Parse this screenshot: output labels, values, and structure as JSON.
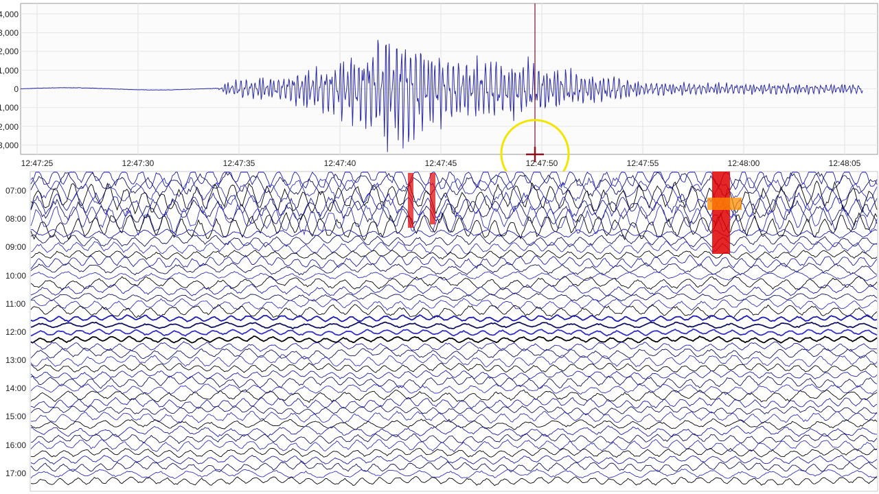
{
  "chart_data": [
    {
      "type": "line",
      "title": "",
      "xlabel": "",
      "ylabel": "",
      "x_ticks": [
        "12:47:25",
        "12:47:30",
        "12:47:35",
        "12:47:40",
        "12:47:45",
        "12:47:50",
        "12:47:55",
        "12:48:00",
        "12:48:05"
      ],
      "y_ticks": [
        {
          "value": 4000,
          "label": "4,000"
        },
        {
          "value": 3000,
          "label": "3,000"
        },
        {
          "value": 2000,
          "label": "2,000"
        },
        {
          "value": 1000,
          "label": "1,000"
        },
        {
          "value": 0,
          "label": "0"
        },
        {
          "value": -1000,
          "label": "-1,000"
        },
        {
          "value": -2000,
          "label": "-2,000"
        },
        {
          "value": -3000,
          "label": "-3,000"
        }
      ],
      "ylim": [
        -3200,
        4500
      ],
      "xlim_seconds": [
        0,
        41.7
      ],
      "grid": true,
      "series_color": "#2a2aa8",
      "envelope": [
        {
          "t": 0,
          "amp": 60
        },
        {
          "t": 9.8,
          "amp": 60
        },
        {
          "t": 10.3,
          "amp": 500
        },
        {
          "t": 13,
          "amp": 900
        },
        {
          "t": 15,
          "amp": 1600
        },
        {
          "t": 17,
          "amp": 2600
        },
        {
          "t": 18.2,
          "amp": 3800
        },
        {
          "t": 19,
          "amp": 3900
        },
        {
          "t": 20.5,
          "amp": 2500
        },
        {
          "t": 22,
          "amp": 1800
        },
        {
          "t": 23.5,
          "amp": 2200
        },
        {
          "t": 25.5,
          "amp": 1700
        },
        {
          "t": 27.5,
          "amp": 1200
        },
        {
          "t": 29,
          "amp": 900
        },
        {
          "t": 31,
          "amp": 450
        },
        {
          "t": 35,
          "amp": 380
        },
        {
          "t": 41.7,
          "amp": 330
        }
      ],
      "cursor_time": "12:47:50",
      "highlight": {
        "shape": "circle",
        "color": "#f2e600",
        "at": "12:47:50"
      }
    },
    {
      "type": "line",
      "title": "",
      "xlabel": "",
      "ylabel": "",
      "row_labels": [
        "07:00",
        "08:00",
        "09:00",
        "10:00",
        "11:00",
        "12:00",
        "13:00",
        "14:00",
        "15:00",
        "16:00",
        "17:00"
      ],
      "traces_per_label": 4,
      "colors": [
        "#1a1ab4",
        "#101060",
        "#3030c8",
        "#000000"
      ],
      "marked_events": [
        {
          "color": "#e00000",
          "label": "red",
          "rows": "07:00-08:00"
        },
        {
          "color": "#ff8c00",
          "label": "orange",
          "rows": "08:00"
        }
      ]
    }
  ]
}
